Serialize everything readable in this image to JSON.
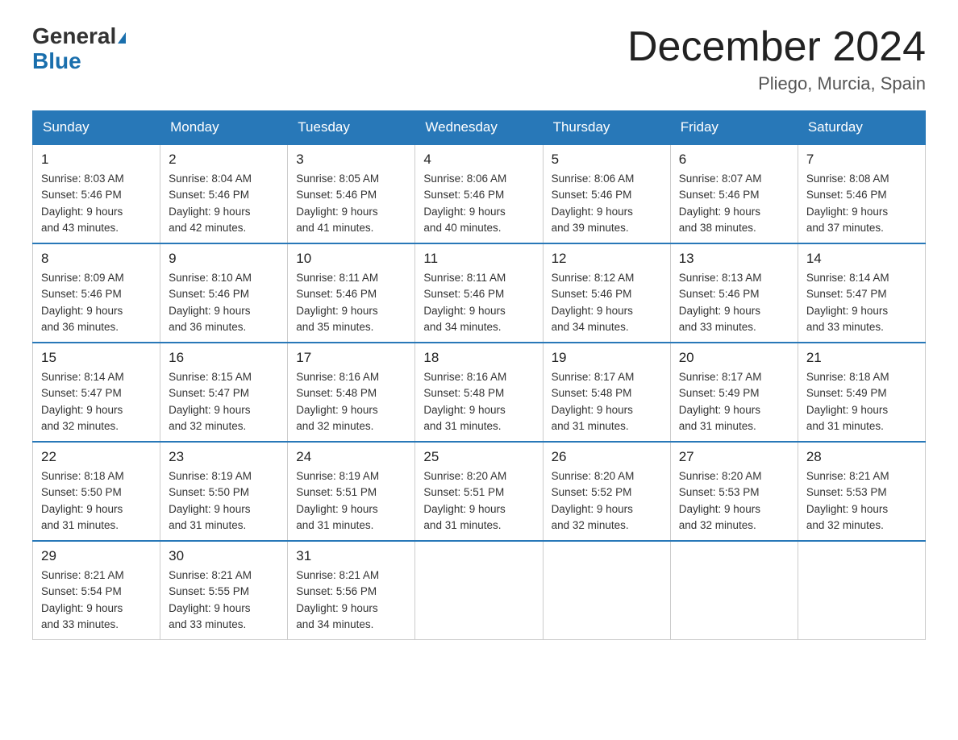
{
  "header": {
    "logo_general": "General",
    "logo_blue": "Blue",
    "title": "December 2024",
    "subtitle": "Pliego, Murcia, Spain"
  },
  "days_of_week": [
    "Sunday",
    "Monday",
    "Tuesday",
    "Wednesday",
    "Thursday",
    "Friday",
    "Saturday"
  ],
  "weeks": [
    [
      {
        "day": "1",
        "sunrise": "8:03 AM",
        "sunset": "5:46 PM",
        "daylight": "9 hours and 43 minutes."
      },
      {
        "day": "2",
        "sunrise": "8:04 AM",
        "sunset": "5:46 PM",
        "daylight": "9 hours and 42 minutes."
      },
      {
        "day": "3",
        "sunrise": "8:05 AM",
        "sunset": "5:46 PM",
        "daylight": "9 hours and 41 minutes."
      },
      {
        "day": "4",
        "sunrise": "8:06 AM",
        "sunset": "5:46 PM",
        "daylight": "9 hours and 40 minutes."
      },
      {
        "day": "5",
        "sunrise": "8:06 AM",
        "sunset": "5:46 PM",
        "daylight": "9 hours and 39 minutes."
      },
      {
        "day": "6",
        "sunrise": "8:07 AM",
        "sunset": "5:46 PM",
        "daylight": "9 hours and 38 minutes."
      },
      {
        "day": "7",
        "sunrise": "8:08 AM",
        "sunset": "5:46 PM",
        "daylight": "9 hours and 37 minutes."
      }
    ],
    [
      {
        "day": "8",
        "sunrise": "8:09 AM",
        "sunset": "5:46 PM",
        "daylight": "9 hours and 36 minutes."
      },
      {
        "day": "9",
        "sunrise": "8:10 AM",
        "sunset": "5:46 PM",
        "daylight": "9 hours and 36 minutes."
      },
      {
        "day": "10",
        "sunrise": "8:11 AM",
        "sunset": "5:46 PM",
        "daylight": "9 hours and 35 minutes."
      },
      {
        "day": "11",
        "sunrise": "8:11 AM",
        "sunset": "5:46 PM",
        "daylight": "9 hours and 34 minutes."
      },
      {
        "day": "12",
        "sunrise": "8:12 AM",
        "sunset": "5:46 PM",
        "daylight": "9 hours and 34 minutes."
      },
      {
        "day": "13",
        "sunrise": "8:13 AM",
        "sunset": "5:46 PM",
        "daylight": "9 hours and 33 minutes."
      },
      {
        "day": "14",
        "sunrise": "8:14 AM",
        "sunset": "5:47 PM",
        "daylight": "9 hours and 33 minutes."
      }
    ],
    [
      {
        "day": "15",
        "sunrise": "8:14 AM",
        "sunset": "5:47 PM",
        "daylight": "9 hours and 32 minutes."
      },
      {
        "day": "16",
        "sunrise": "8:15 AM",
        "sunset": "5:47 PM",
        "daylight": "9 hours and 32 minutes."
      },
      {
        "day": "17",
        "sunrise": "8:16 AM",
        "sunset": "5:48 PM",
        "daylight": "9 hours and 32 minutes."
      },
      {
        "day": "18",
        "sunrise": "8:16 AM",
        "sunset": "5:48 PM",
        "daylight": "9 hours and 31 minutes."
      },
      {
        "day": "19",
        "sunrise": "8:17 AM",
        "sunset": "5:48 PM",
        "daylight": "9 hours and 31 minutes."
      },
      {
        "day": "20",
        "sunrise": "8:17 AM",
        "sunset": "5:49 PM",
        "daylight": "9 hours and 31 minutes."
      },
      {
        "day": "21",
        "sunrise": "8:18 AM",
        "sunset": "5:49 PM",
        "daylight": "9 hours and 31 minutes."
      }
    ],
    [
      {
        "day": "22",
        "sunrise": "8:18 AM",
        "sunset": "5:50 PM",
        "daylight": "9 hours and 31 minutes."
      },
      {
        "day": "23",
        "sunrise": "8:19 AM",
        "sunset": "5:50 PM",
        "daylight": "9 hours and 31 minutes."
      },
      {
        "day": "24",
        "sunrise": "8:19 AM",
        "sunset": "5:51 PM",
        "daylight": "9 hours and 31 minutes."
      },
      {
        "day": "25",
        "sunrise": "8:20 AM",
        "sunset": "5:51 PM",
        "daylight": "9 hours and 31 minutes."
      },
      {
        "day": "26",
        "sunrise": "8:20 AM",
        "sunset": "5:52 PM",
        "daylight": "9 hours and 32 minutes."
      },
      {
        "day": "27",
        "sunrise": "8:20 AM",
        "sunset": "5:53 PM",
        "daylight": "9 hours and 32 minutes."
      },
      {
        "day": "28",
        "sunrise": "8:21 AM",
        "sunset": "5:53 PM",
        "daylight": "9 hours and 32 minutes."
      }
    ],
    [
      {
        "day": "29",
        "sunrise": "8:21 AM",
        "sunset": "5:54 PM",
        "daylight": "9 hours and 33 minutes."
      },
      {
        "day": "30",
        "sunrise": "8:21 AM",
        "sunset": "5:55 PM",
        "daylight": "9 hours and 33 minutes."
      },
      {
        "day": "31",
        "sunrise": "8:21 AM",
        "sunset": "5:56 PM",
        "daylight": "9 hours and 34 minutes."
      },
      null,
      null,
      null,
      null
    ]
  ],
  "labels": {
    "sunrise": "Sunrise:",
    "sunset": "Sunset:",
    "daylight": "Daylight:"
  }
}
